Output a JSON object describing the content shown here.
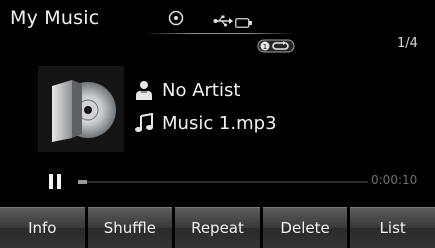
{
  "header": {
    "title": "My Music",
    "icons": [
      "disc-icon",
      "usb-icon",
      "ipod-icon"
    ]
  },
  "playback": {
    "repeat_icon": "repeat-one-icon",
    "track_counter": "1/4",
    "artist": "No Artist",
    "file": "Music 1.mp3",
    "artist_icon": "person-icon",
    "file_icon": "music-note-icon",
    "elapsed": "0:00:10",
    "progress": 0.03,
    "state": "playing"
  },
  "buttons": [
    {
      "label": "Info"
    },
    {
      "label": "Shuffle"
    },
    {
      "label": "Repeat"
    },
    {
      "label": "Delete"
    },
    {
      "label": "List"
    }
  ],
  "colors": {
    "background": "#000000",
    "button_top": "#5c5c5c",
    "button_bottom": "#2a2a2a",
    "text": "#f2f2f2",
    "time_text": "#6f6f6f"
  }
}
